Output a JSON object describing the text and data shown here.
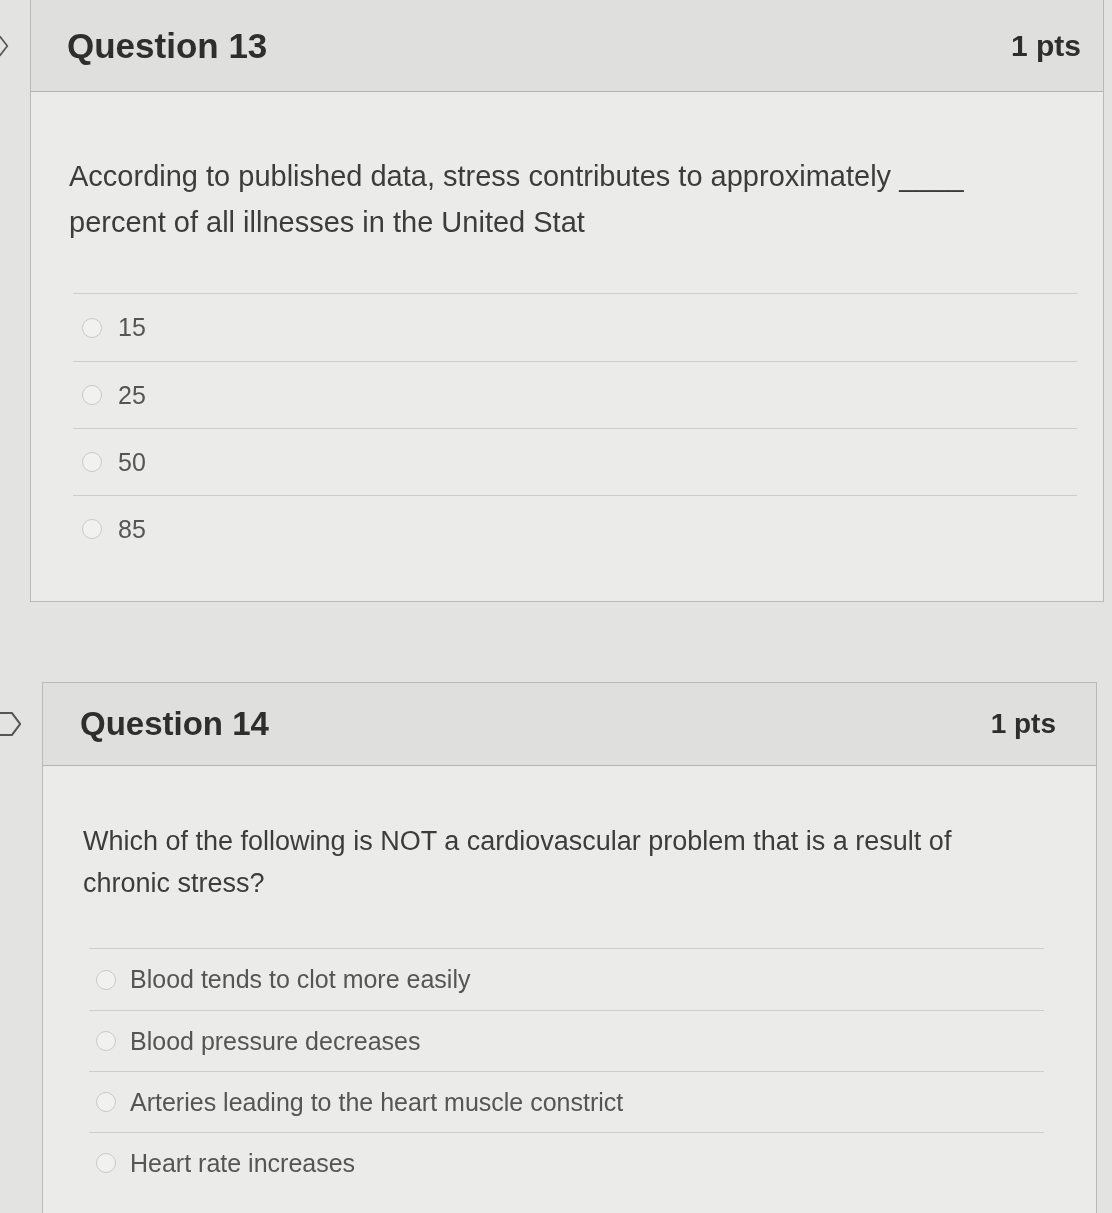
{
  "questions": [
    {
      "title": "Question 13",
      "points": "1 pts",
      "flagged": false,
      "text": "According to published data, stress contributes to approximately ____ percent of all illnesses in the United Stat",
      "answers": [
        {
          "label": "15",
          "selected": false
        },
        {
          "label": "25",
          "selected": false
        },
        {
          "label": "50",
          "selected": false
        },
        {
          "label": "85",
          "selected": false
        }
      ]
    },
    {
      "title": "Question 14",
      "points": "1 pts",
      "flagged": false,
      "text": "Which of the following is NOT a cardiovascular problem that is a result of chronic stress?",
      "answers": [
        {
          "label": "Blood tends to clot more easily",
          "selected": false
        },
        {
          "label": "Blood pressure decreases",
          "selected": false
        },
        {
          "label": "Arteries leading to the heart muscle constrict",
          "selected": false
        },
        {
          "label": "Heart rate increases",
          "selected": false
        }
      ]
    }
  ]
}
